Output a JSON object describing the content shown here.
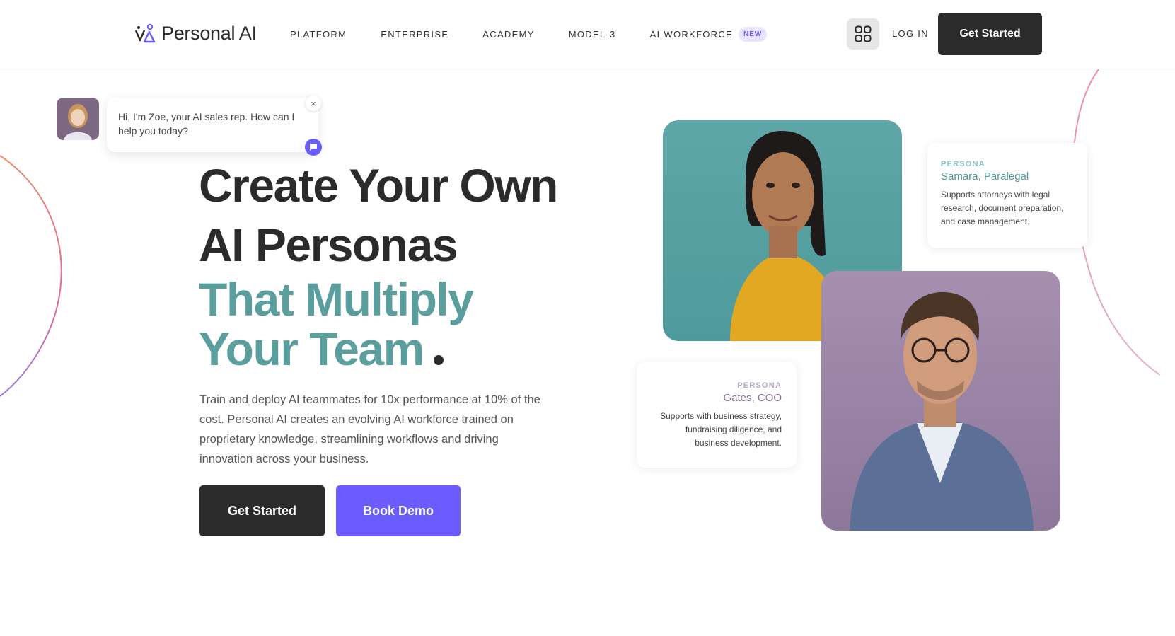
{
  "header": {
    "logo_text": "Personal AI",
    "nav": [
      {
        "label": "PLATFORM"
      },
      {
        "label": "ENTERPRISE"
      },
      {
        "label": "ACADEMY"
      },
      {
        "label": "MODEL-3"
      },
      {
        "label": "AI WORKFORCE",
        "badge": "NEW"
      }
    ],
    "apps_icon": "grid-icon",
    "login_label": "LOG IN",
    "cta_label": "Get Started"
  },
  "chat": {
    "message": "Hi, I'm Zoe, your AI sales rep. How can I help you today?",
    "close_label": "×",
    "icons": {
      "close": "close-icon",
      "open": "chat-icon"
    }
  },
  "hero": {
    "title_line1": "Create Your Own",
    "title_line2": "AI Personas",
    "accent_line1": "That Multiply",
    "accent_line2": "Your Team",
    "description": "Train and deploy AI teammates for 10x performance at 10% of the cost. Personal AI creates an evolving AI workforce trained on proprietary knowledge, streamlining workflows and driving innovation across your business.",
    "primary_button": "Get Started",
    "demo_button": "Book Demo"
  },
  "personas": [
    {
      "tag": "PERSONA",
      "name": "Samara, Paralegal",
      "description": "Supports attorneys with legal research, document preparation, and case management."
    },
    {
      "tag": "PERSONA",
      "name": "Gates, COO",
      "description": "Supports with business strategy, fundraising diligence, and business development."
    }
  ],
  "colors": {
    "brand_dark": "#2b2b2b",
    "brand_purple": "#6b5cff",
    "accent_teal": "#5a9e9e"
  }
}
